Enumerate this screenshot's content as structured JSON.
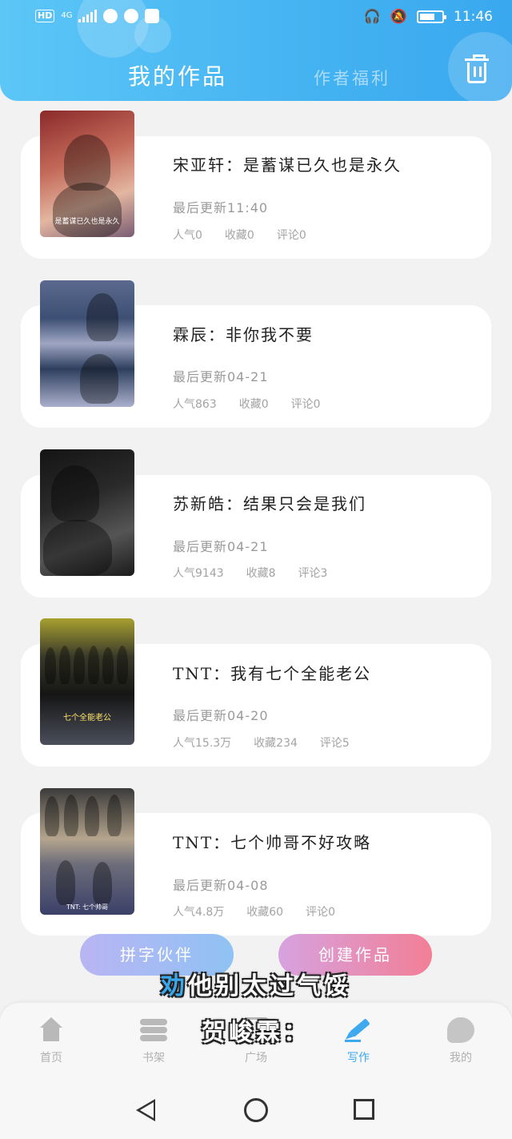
{
  "status_bar": {
    "left_badges": [
      "HD",
      "4G"
    ],
    "time": "11:46"
  },
  "header": {
    "tab_mine": "我的作品",
    "tab_welfare": "作者福利"
  },
  "works": [
    {
      "title": "宋亚轩：是蓄谋已久也是永久",
      "updated": "最后更新11:40",
      "popularity": "人气0",
      "favorites": "收藏0",
      "comments": "评论0",
      "cover_caption": "是蓄谋已久也是永久"
    },
    {
      "title": "霖辰：非你我不要",
      "updated": "最后更新04-21",
      "popularity": "人气863",
      "favorites": "收藏0",
      "comments": "评论0",
      "cover_caption": ""
    },
    {
      "title": "苏新皓：结果只会是我们",
      "updated": "最后更新04-21",
      "popularity": "人气9143",
      "favorites": "收藏8",
      "comments": "评论3",
      "cover_caption": ""
    },
    {
      "title": "TNT：我有七个全能老公",
      "updated": "最后更新04-20",
      "popularity": "人气15.3万",
      "favorites": "收藏234",
      "comments": "评论5",
      "cover_caption": "七个全能老公"
    },
    {
      "title": "TNT：七个帅哥不好攻略",
      "updated": "最后更新04-08",
      "popularity": "人气4.8万",
      "favorites": "收藏60",
      "comments": "评论0",
      "cover_caption": "TNT: 七个帅哥"
    }
  ],
  "actions": {
    "partner": "拼字伙伴",
    "create": "创建作品"
  },
  "bottom_nav": [
    {
      "label": "首页",
      "icon": "home-icon"
    },
    {
      "label": "书架",
      "icon": "bookshelf-icon"
    },
    {
      "label": "广场",
      "icon": "square-icon"
    },
    {
      "label": "写作",
      "icon": "write-icon",
      "active": true
    },
    {
      "label": "我的",
      "icon": "mine-icon"
    }
  ],
  "overlay": {
    "line1_highlight": "劝",
    "line1_rest": "他别太过气馁",
    "line2": "贺峻霖："
  },
  "colors": {
    "accent": "#3ea9ef",
    "header_start": "#5cc6f7",
    "header_end": "#3aa8ef",
    "partner_start": "#b9b5f3",
    "create_end": "#f27f96"
  }
}
